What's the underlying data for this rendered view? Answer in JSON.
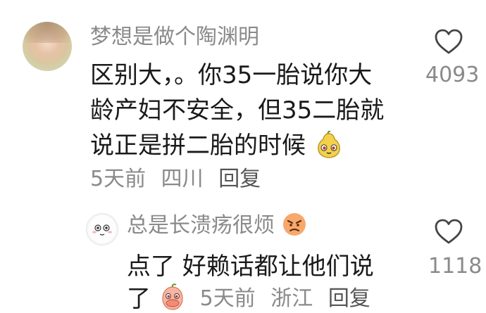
{
  "comments": [
    {
      "username": "梦想是做个陶渊明",
      "lines": [
        "区别大，。你35一胎说你大",
        "龄产妇不安全，但35二胎就",
        "说正是拼二胎的时候"
      ],
      "emoji_after_text": "pear-face-emoji",
      "time": "5天前",
      "location": "四川",
      "reply_label": "回复",
      "likes": "4093"
    },
    {
      "username": "总是长溃疡很烦",
      "username_emoji": "angry-face-emoji",
      "lines": [
        "点了 好赖话都让他们说",
        "了"
      ],
      "emoji_after_text": "covering-mouth-peach-emoji",
      "time": "5天前",
      "location": "浙江",
      "reply_label": "回复",
      "likes": "1118"
    }
  ],
  "colors": {
    "text": "#1a1a1a",
    "secondary": "#8a8a8a",
    "background": "#ffffff"
  }
}
